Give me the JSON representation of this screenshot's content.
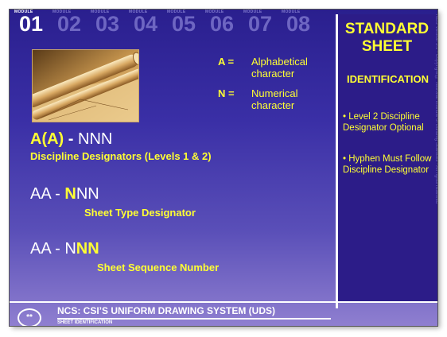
{
  "modules": {
    "tag": "MODULE",
    "numbers": [
      "01",
      "02",
      "03",
      "04",
      "05",
      "06",
      "07",
      "08"
    ],
    "active": "01"
  },
  "image": {
    "name": "rolled-blueprints-photo"
  },
  "legend": [
    {
      "key": "A =",
      "value": "Alphabetical character"
    },
    {
      "key": "N =",
      "value": "Numerical character"
    }
  ],
  "lines": [
    {
      "parts": [
        {
          "t": "A(A)",
          "y": true
        },
        {
          "t": " - ",
          "y": false
        },
        {
          "t": "NNN",
          "y": false
        }
      ],
      "caption": "Discipline Designators (Levels 1 & 2)"
    },
    {
      "parts": [
        {
          "t": "AA - ",
          "y": false
        },
        {
          "t": "N",
          "y": true
        },
        {
          "t": "NN",
          "y": false
        }
      ],
      "caption": "Sheet Type Designator"
    },
    {
      "parts": [
        {
          "t": "AA - N",
          "y": false
        },
        {
          "t": "NN",
          "y": true
        }
      ],
      "caption": "Sheet Sequence Number"
    }
  ],
  "sidebar": {
    "title": "STANDARD SHEET",
    "subtitle": "IDENTIFICATION",
    "bullets": [
      "• Level 2 Discipline Designator Optional",
      "• Hyphen Must Follow Discipline Designator"
    ]
  },
  "side_text": "NCS Version 3.1 • Copyright © National Institute of Building Sciences • All rights reserved",
  "footer": {
    "circle": "**",
    "title": "NCS: CSI’S UNIFORM DRAWING SYSTEM (UDS)",
    "subtitle": "SHEET IDENTIFICATION"
  },
  "colors": {
    "background": "#3a2fa6",
    "accent": "#ffff33",
    "sidebar": "#2c1c88",
    "text": "#ffffff"
  }
}
